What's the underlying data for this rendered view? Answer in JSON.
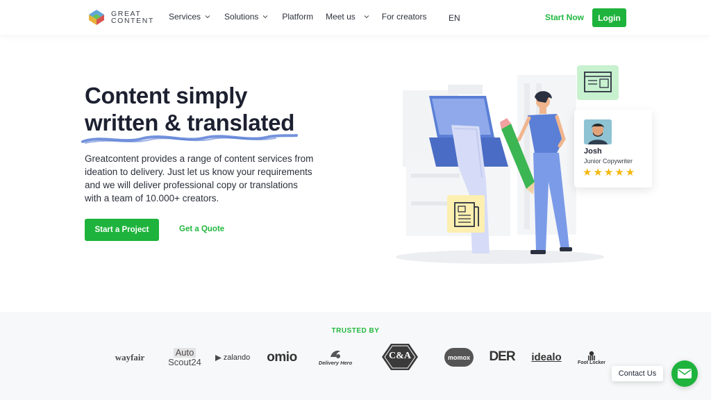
{
  "header": {
    "logo_line1": "GREAT",
    "logo_line2": "CONTENT",
    "nav": [
      {
        "label": "Services",
        "has_dropdown": true
      },
      {
        "label": "Solutions",
        "has_dropdown": true
      },
      {
        "label": "Platform",
        "has_dropdown": false
      },
      {
        "label": "Meet us",
        "has_dropdown": true
      },
      {
        "label": "For creators",
        "has_dropdown": false
      }
    ],
    "language": "EN",
    "start_now": "Start Now",
    "login": "Login"
  },
  "hero": {
    "title_line1": "Content simply",
    "title_line2": "written & translated",
    "description": "Greatcontent provides a range of content services from ideation to delivery. Just let us know your requirements and we will deliver professional copy or translations with a team of 10.000+ creators.",
    "cta_primary": "Start a Project",
    "cta_secondary": "Get a Quote"
  },
  "profile_card": {
    "name": "Josh",
    "role": "Junior Copywriter",
    "rating": 5
  },
  "trusted": {
    "label": "TRUSTED BY",
    "brands": {
      "wayfair": "wayfair",
      "autoscout_line1": "Auto",
      "autoscout_line2": "Scout24",
      "zalando": "zalando",
      "omio": "omio",
      "deliveryhero": "Delivery Hero",
      "candA": "C&A",
      "momox": "momox",
      "der": "DER",
      "idealo": "idealo",
      "footlocker": "Foot Locker"
    }
  },
  "contact": {
    "label": "Contact Us"
  },
  "colors": {
    "brand_green": "#1eb33c",
    "accent_blue": "#5b7fd6",
    "star_yellow": "#f5b80f"
  }
}
